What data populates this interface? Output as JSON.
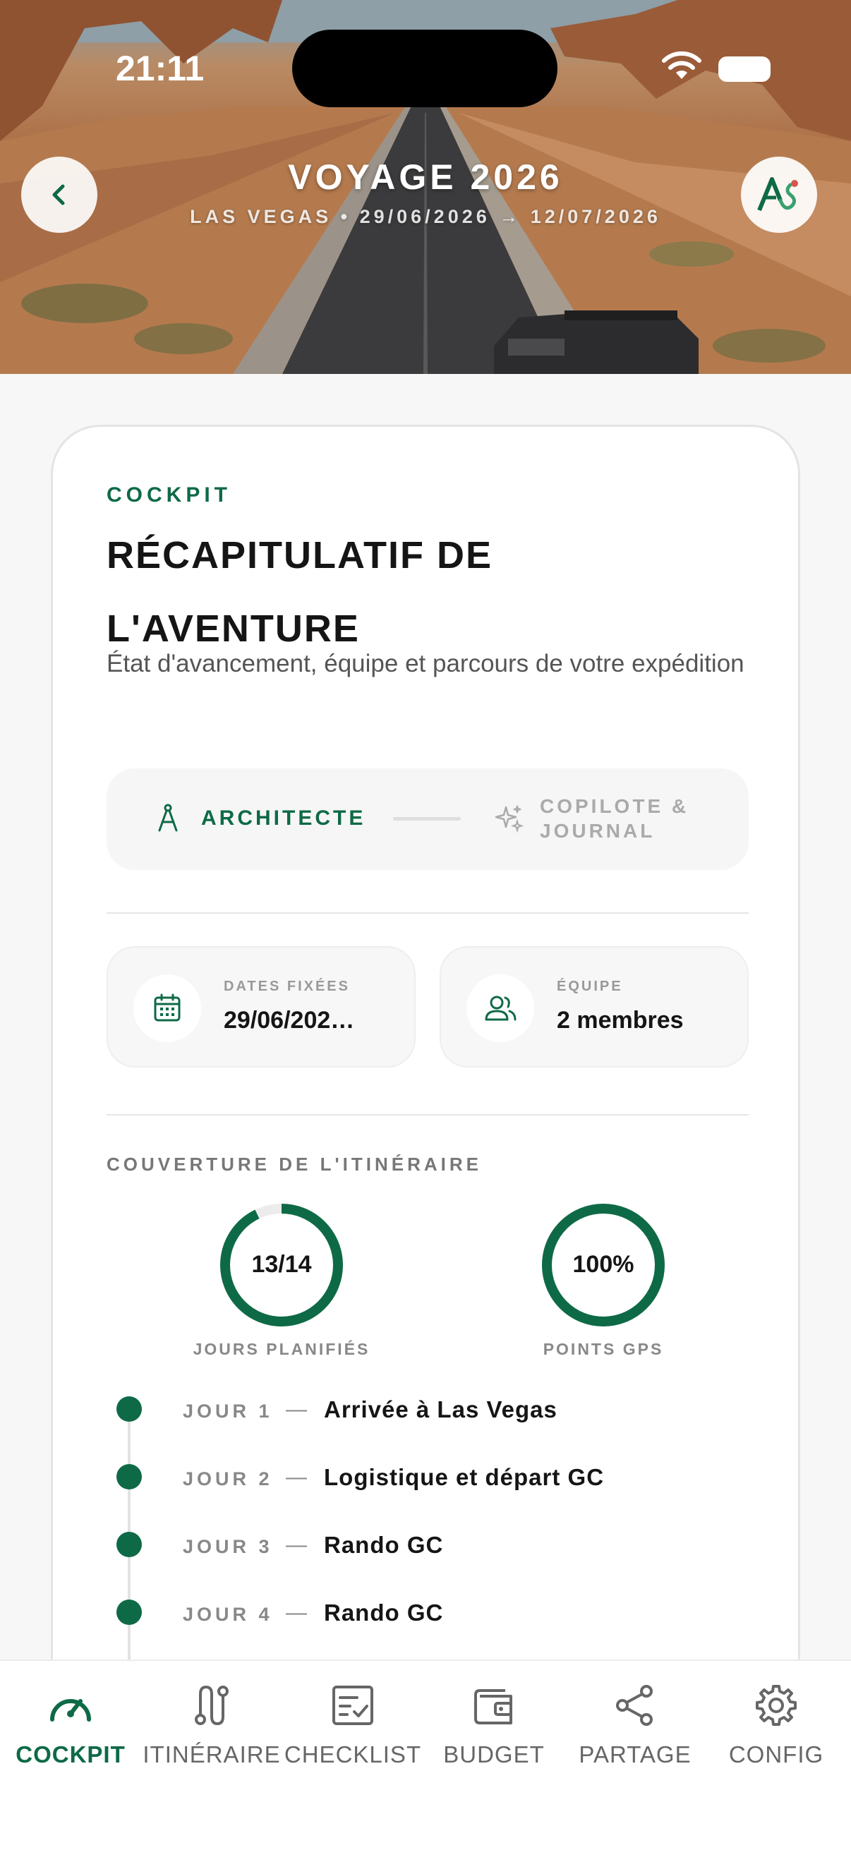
{
  "status_bar": {
    "time": "21:11"
  },
  "header": {
    "title": "VOYAGE 2026",
    "subtitle": "LAS VEGAS • 29/06/2026 → 12/07/2026",
    "back_icon": "chevron-left-icon",
    "logo_icon": "app-logo-icon"
  },
  "card": {
    "eyebrow": "COCKPIT",
    "title": "RÉCAPITULATIF DE L'AVENTURE",
    "description": "État d'avancement, équipe et parcours de votre expédition",
    "modes": {
      "active": {
        "label": "ARCHITECTE",
        "icon": "compass-icon"
      },
      "inactive": {
        "label": "COPILOTE & JOURNAL",
        "icon": "sparkles-icon"
      }
    },
    "dates": {
      "label": "DATES FIXÉES",
      "value": "29/06/202…",
      "icon": "calendar-icon"
    },
    "team": {
      "label": "ÉQUIPE",
      "value": "2 membres",
      "icon": "users-icon"
    },
    "coverage": {
      "label": "COUVERTURE DE L'ITINÉRAIRE",
      "days": {
        "text": "13/14",
        "caption": "JOURS PLANIFIÉS",
        "progress": 0.9286
      },
      "gps": {
        "text": "100%",
        "caption": "POINTS GPS",
        "progress": 1.0
      }
    },
    "timeline": [
      {
        "day": "JOUR 1",
        "sep": "—",
        "title": "Arrivée à Las Vegas"
      },
      {
        "day": "JOUR 2",
        "sep": "—",
        "title": "Logistique et départ GC"
      },
      {
        "day": "JOUR 3",
        "sep": "—",
        "title": "Rando GC"
      },
      {
        "day": "JOUR 4",
        "sep": "—",
        "title": "Rando GC"
      }
    ]
  },
  "tabs": [
    {
      "label": "COCKPIT",
      "icon": "speedometer-icon",
      "active": true
    },
    {
      "label": "ITINÉRAIRE",
      "icon": "route-icon",
      "active": false
    },
    {
      "label": "CHECKLIST",
      "icon": "checklist-icon",
      "active": false
    },
    {
      "label": "BUDGET",
      "icon": "wallet-icon",
      "active": false
    },
    {
      "label": "PARTAGE",
      "icon": "share-icon",
      "active": false
    },
    {
      "label": "CONFIG",
      "icon": "gear-icon",
      "active": false
    }
  ],
  "colors": {
    "accent": "#0e6a46",
    "muted": "#888888",
    "card_bg": "#ffffff"
  }
}
